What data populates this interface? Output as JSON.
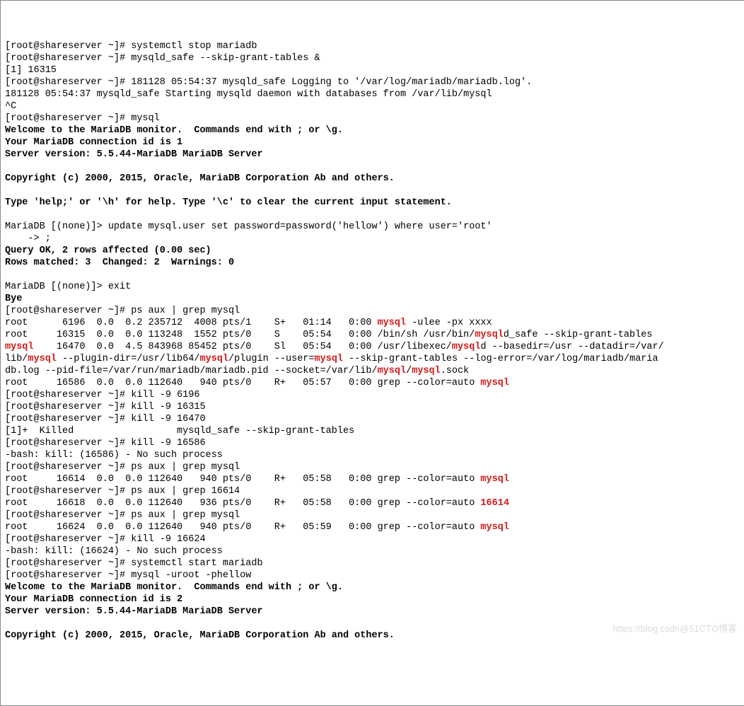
{
  "prompt": "[root@shareserver ~]# ",
  "mariadb_prompt": "MariaDB [(none)]> ",
  "cont_prompt": "    -> ",
  "cmds": {
    "stop": "systemctl stop mariadb",
    "safe": "mysqld_safe --skip-grant-tables &",
    "job": "[1] 16315",
    "logline1": "181128 05:54:37 mysqld_safe Logging to '/var/log/mariadb/mariadb.log'.",
    "logline2": "181128 05:54:37 mysqld_safe Starting mysqld daemon with databases from /var/lib/mysql",
    "ctrlc": "^C",
    "mysql": "mysql",
    "welcome": "Welcome to the MariaDB monitor.  Commands end with ; or \\g.",
    "connid1": "Your MariaDB connection id is 1",
    "version": "Server version: 5.5.44-MariaDB MariaDB Server",
    "copyright": "Copyright (c) 2000, 2015, Oracle, MariaDB Corporation Ab and others.",
    "helpline": "Type 'help;' or '\\h' for help. Type '\\c' to clear the current input statement.",
    "update": "update mysql.user set password=password('hellow') where user='root'",
    "semi": ";",
    "qok": "Query OK, 2 rows affected (0.00 sec)",
    "rows": "Rows matched: 3  Changed: 2  Warnings: 0",
    "exit": "exit",
    "bye": "Bye",
    "psaux": "ps aux | grep mysql",
    "ps1": {
      "pre": "root      6196  0.0  0.2 235712  4008 pts/1    S+   01:14   0:00 ",
      "hl": "mysql",
      "post": " -ulee -px xxxx"
    },
    "ps2": {
      "pre": "root     16315  0.0  0.0 113248  1552 pts/0    S    05:54   0:00 /bin/sh /usr/bin/",
      "hl": "mysql",
      "post": "d_safe --skip-grant-tables"
    },
    "ps3": {
      "a_hl": "mysql",
      "a_post": "    16470  0.0  4.5 843968 85452 pts/0    Sl   05:54   0:00 /usr/libexec/",
      "b_hl": "mysql",
      "b_post": "d --basedir=/usr --datadir=/var/"
    },
    "ps3b": {
      "pre1": "lib/",
      "hl1": "mysql",
      "mid1": " --plugin-dir=/usr/lib64/",
      "hl2": "mysql",
      "mid2": "/plugin --user=",
      "hl3": "mysql",
      "mid3": " --skip-grant-tables --log-error=/var/log/mariadb/maria"
    },
    "ps3c": {
      "pre": "db.log --pid-file=/var/run/mariadb/mariadb.pid --socket=/var/lib/",
      "hl1": "mysql",
      "mid": "/",
      "hl2": "mysql",
      "post": ".sock"
    },
    "ps4": {
      "pre": "root     16586  0.0  0.0 112640   940 pts/0    R+   05:57   0:00 grep --color=auto ",
      "hl": "mysql"
    },
    "kill1": "kill -9 6196",
    "kill2": "kill -9 16315",
    "kill3": "kill -9 16470",
    "killed": "[1]+  Killed                  mysqld_safe --skip-grant-tables",
    "kill4": "kill -9 16586",
    "nosuch1": "-bash: kill: (16586) - No such process",
    "ps5": {
      "pre": "root     16614  0.0  0.0 112640   940 pts/0    R+   05:58   0:00 grep --color=auto ",
      "hl": "mysql"
    },
    "psaux2": "ps aux | grep 16614",
    "ps6": {
      "pre": "root     16618  0.0  0.0 112640   936 pts/0    R+   05:58   0:00 grep --color=auto ",
      "hl": "16614"
    },
    "ps7": {
      "pre": "root     16624  0.0  0.0 112640   940 pts/0    R+   05:59   0:00 grep --color=auto ",
      "hl": "mysql"
    },
    "kill5": "kill -9 16624",
    "nosuch2": "-bash: kill: (16624) - No such process",
    "start": "systemctl start mariadb",
    "login": "mysql -uroot -phellow",
    "connid2": "Your MariaDB connection id is 2"
  },
  "watermark": "https://blog.csdn@51CTO博客"
}
